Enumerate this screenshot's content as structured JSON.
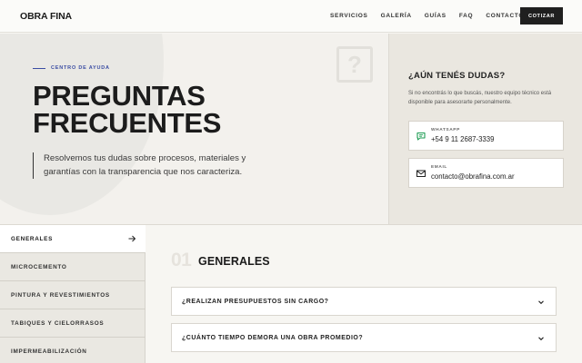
{
  "header": {
    "logo": "OBRA FINA",
    "nav": [
      "SERVICIOS",
      "GALERÍA",
      "GUÍAS",
      "FAQ",
      "CONTACTO"
    ],
    "cta_label": "COTIZAR"
  },
  "hero": {
    "eyebrow": "CENTRO DE AYUDA",
    "title_line1": "PREGUNTAS",
    "title_line2": "FRECUENTES",
    "lead": "Resolvemos tus dudas sobre procesos, materiales y garantías con la transparencia que nos caracteriza.",
    "decor_icon": "question-icon"
  },
  "help": {
    "title": "¿AÚN TENÉS DUDAS?",
    "description": "Si no encontrás lo que buscás, nuestro equipo técnico está disponible para asesorarte personalmente.",
    "whatsapp": {
      "label": "WHATSAPP",
      "value": "+54 9 11 2687-3339",
      "icon": "whatsapp-icon"
    },
    "email": {
      "label": "EMAIL",
      "value": "contacto@obrafina.com.ar",
      "icon": "mail-icon"
    }
  },
  "categories": [
    {
      "label": "GENERALES",
      "active": true
    },
    {
      "label": "MICROCEMENTO",
      "active": false
    },
    {
      "label": "PINTURA Y REVESTIMIENTOS",
      "active": false
    },
    {
      "label": "TABIQUES Y CIELORRASOS",
      "active": false
    },
    {
      "label": "IMPERMEABILIZACIÓN",
      "active": false
    }
  ],
  "section": {
    "number": "01",
    "title": "GENERALES",
    "questions": [
      "¿REALIZAN PRESUPUESTOS SIN CARGO?",
      "¿CUÁNTO TIEMPO DEMORA UNA OBRA PROMEDIO?"
    ]
  },
  "colors": {
    "accent": "#3b4da3",
    "dark": "#1f1f1f",
    "whatsapp": "#1f9d55"
  }
}
